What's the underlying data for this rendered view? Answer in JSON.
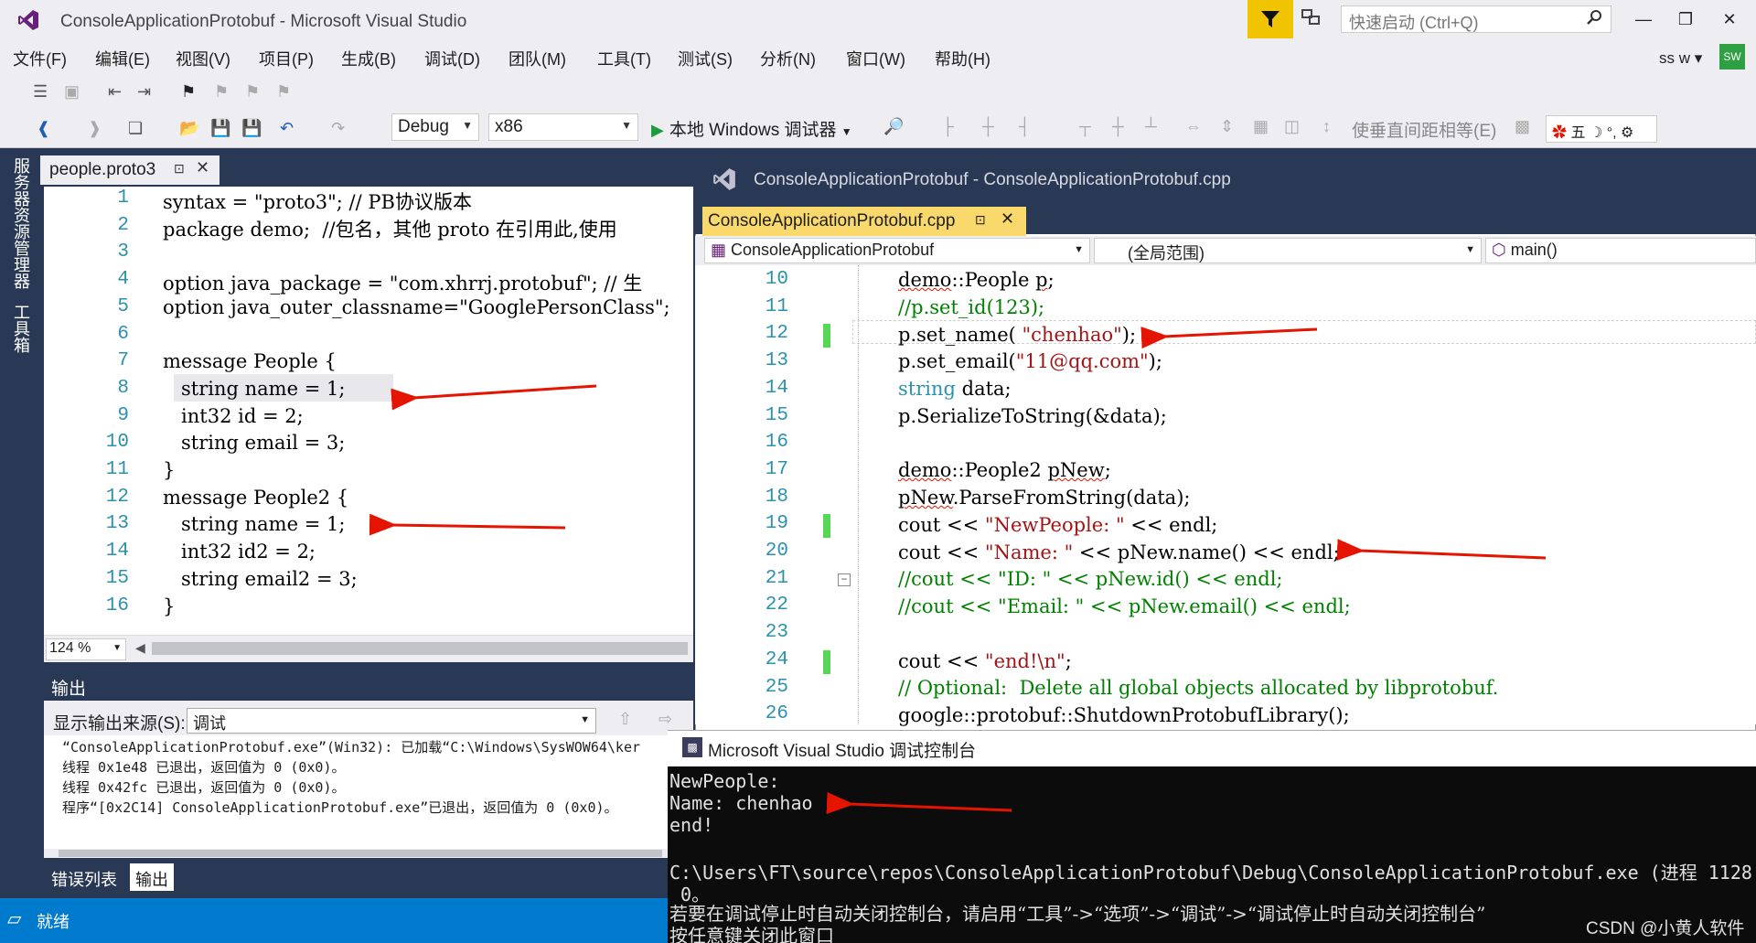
{
  "app": {
    "title": "ConsoleApplicationProtobuf - Microsoft Visual Studio",
    "quick_launch_placeholder": "快速启动 (Ctrl+Q)",
    "user_name": "ss w",
    "user_initials": "SW"
  },
  "menu": [
    "文件(F)",
    "编辑(E)",
    "视图(V)",
    "项目(P)",
    "生成(B)",
    "调试(D)",
    "团队(M)",
    "工具(T)",
    "测试(S)",
    "分析(N)",
    "窗口(W)",
    "帮助(H)"
  ],
  "toolbar": {
    "configuration": "Debug",
    "platform": "x86",
    "run_label": "本地 Windows 调试器",
    "align_label": "使垂直间距相等(E)"
  },
  "left_tabs": [
    "服务器资源管理器",
    "工具箱"
  ],
  "proto_editor": {
    "tab": "people.proto3",
    "zoom": "124 %",
    "lines": [
      {
        "n": "1",
        "text": "syntax = \"proto3\"; // PB协议版本"
      },
      {
        "n": "2",
        "text": "package demo;  //包名，其他 proto 在引用此,使用"
      },
      {
        "n": "3",
        "text": ""
      },
      {
        "n": "4",
        "text": "option java_package = \"com.xhrrj.protobuf\"; // 生"
      },
      {
        "n": "5",
        "text": "option java_outer_classname=\"GooglePersonClass\";"
      },
      {
        "n": "6",
        "text": ""
      },
      {
        "n": "7",
        "text": "message People {"
      },
      {
        "n": "8",
        "text": "   string name = 1;"
      },
      {
        "n": "9",
        "text": "   int32 id = 2;"
      },
      {
        "n": "10",
        "text": "   string email = 3;"
      },
      {
        "n": "11",
        "text": "}"
      },
      {
        "n": "12",
        "text": "message People2 {"
      },
      {
        "n": "13",
        "text": "   string name = 1;"
      },
      {
        "n": "14",
        "text": "   int32 id2 = 2;"
      },
      {
        "n": "15",
        "text": "   string email2 = 3;"
      },
      {
        "n": "16",
        "text": "}"
      }
    ]
  },
  "output_panel": {
    "title": "输出",
    "source_label": "显示输出来源(S):",
    "source_value": "调试",
    "lines": [
      "“ConsoleApplicationProtobuf.exe”(Win32): 已加载“C:\\Windows\\SysWOW64\\ker",
      "线程 0x1e48 已退出，返回值为 0 (0x0)。",
      "线程 0x42fc 已退出，返回值为 0 (0x0)。",
      "程序“[0x2C14] ConsoleApplicationProtobuf.exe”已退出，返回值为 0 (0x0)。"
    ],
    "tabs": [
      "错误列表",
      "输出"
    ]
  },
  "status": {
    "text": "就绪"
  },
  "cpp_window": {
    "title": "ConsoleApplicationProtobuf - ConsoleApplicationProtobuf.cpp",
    "tab": "ConsoleApplicationProtobuf.cpp",
    "nav_project": "ConsoleApplicationProtobuf",
    "nav_scope": "(全局范围)",
    "nav_member": "main()",
    "line_numbers": [
      "10",
      "11",
      "12",
      "13",
      "14",
      "15",
      "16",
      "17",
      "18",
      "19",
      "20",
      "21",
      "22",
      "23",
      "24",
      "25",
      "26"
    ]
  },
  "console": {
    "title": "Microsoft Visual Studio 调试控制台",
    "lines": [
      "NewPeople:",
      "Name: chenhao",
      "end!",
      "",
      "C:\\Users\\FT\\source\\repos\\ConsoleApplicationProtobuf\\Debug\\ConsoleApplicationProtobuf.exe (进程 1128",
      " 0。",
      "若要在调试停止时自动关闭控制台，请启用“工具”->“选项”->“调试”->“调试停止时自动关闭控制台”",
      "按任意键关闭此窗口"
    ],
    "watermark": "CSDN @小黄人软件"
  },
  "colors": {
    "vs_navy": "#293955",
    "accent_yellow": "#f0c400",
    "status_blue": "#007acc",
    "annotation_red": "#e51400"
  }
}
